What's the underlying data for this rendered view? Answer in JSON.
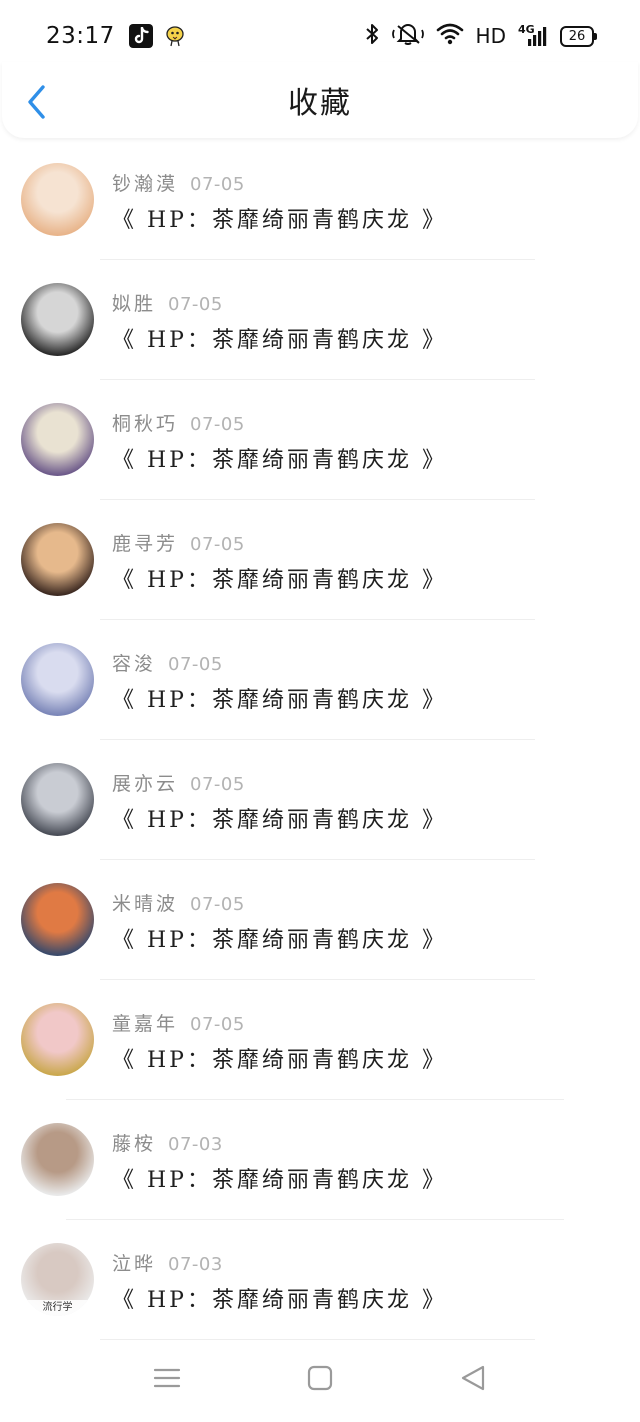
{
  "status_bar": {
    "time": "23:17",
    "network_label": "HD",
    "network_gen": "4G",
    "battery": "26"
  },
  "header": {
    "title": "收藏"
  },
  "items": [
    {
      "name": "钞瀚漠",
      "date": "07-05",
      "title": "《 HP：茶靡绮丽青鹤庆龙 》",
      "avatar_colors": [
        "#e8b48a",
        "#f6e3d2"
      ]
    },
    {
      "name": "姒胜",
      "date": "07-05",
      "title": "《 HP：茶靡绮丽青鹤庆龙 》",
      "avatar_colors": [
        "#2b2b2b",
        "#d6d6d6"
      ]
    },
    {
      "name": "桐秋巧",
      "date": "07-05",
      "title": "《 HP：茶靡绮丽青鹤庆龙 》",
      "avatar_colors": [
        "#6d5a8a",
        "#e9e2d2"
      ]
    },
    {
      "name": "鹿寻芳",
      "date": "07-05",
      "title": "《 HP：茶靡绮丽青鹤庆龙 》",
      "avatar_colors": [
        "#3d2a22",
        "#e6b98c"
      ]
    },
    {
      "name": "容浚",
      "date": "07-05",
      "title": "《 HP：茶靡绮丽青鹤庆龙 》",
      "avatar_colors": [
        "#7b86b8",
        "#d9dcef"
      ]
    },
    {
      "name": "展亦云",
      "date": "07-05",
      "title": "《 HP：茶靡绮丽青鹤庆龙 》",
      "avatar_colors": [
        "#4a4e58",
        "#c9ccd3"
      ]
    },
    {
      "name": "米晴波",
      "date": "07-05",
      "title": "《 HP：茶靡绮丽青鹤庆龙 》",
      "avatar_colors": [
        "#3a4a6b",
        "#e07a44"
      ]
    },
    {
      "name": "童嘉年",
      "date": "07-05",
      "title": "《 HP：茶靡绮丽青鹤庆龙 》",
      "avatar_colors": [
        "#caa84e",
        "#f1c8c8"
      ]
    },
    {
      "name": "藤桉",
      "date": "07-03",
      "title": "《 HP：茶靡绮丽青鹤庆龙 》",
      "avatar_colors": [
        "#e9e9e9",
        "#b79a86"
      ]
    },
    {
      "name": "泣晔",
      "date": "07-03",
      "title": "《 HP：茶靡绮丽青鹤庆龙 》",
      "avatar_colors": [
        "#ececec",
        "#d8c9c2"
      ],
      "avatar_text": "流行学"
    }
  ],
  "nav": {
    "menu_icon": "menu-icon",
    "home_icon": "square-home-icon",
    "back_icon": "triangle-back-icon"
  },
  "colors": {
    "accent": "#2f8fe8",
    "name_gray": "#8c8c8c",
    "date_gray": "#b3b3b3"
  }
}
